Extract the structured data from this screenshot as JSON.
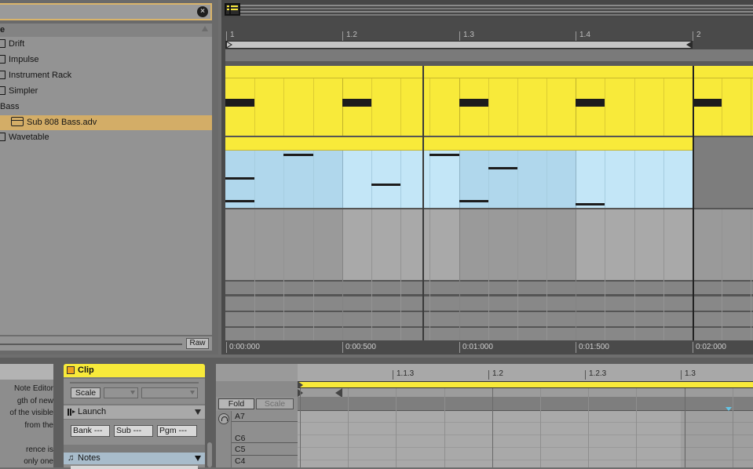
{
  "browser": {
    "search_value": "",
    "clear_icon": "close-circle-icon",
    "header_label": "e",
    "sort_icon": "sort-up-icon",
    "items": [
      {
        "label": "Drift",
        "type": "device",
        "indent": 0,
        "selected": false
      },
      {
        "label": "Impulse",
        "type": "device",
        "indent": 0,
        "selected": false
      },
      {
        "label": "Instrument Rack",
        "type": "device",
        "indent": 0,
        "selected": false
      },
      {
        "label": "Simpler",
        "type": "device",
        "indent": 0,
        "selected": false
      },
      {
        "label": "Bass",
        "type": "folder",
        "indent": 0,
        "selected": false
      },
      {
        "label": "Sub 808 Bass.adv",
        "type": "preset",
        "indent": 1,
        "selected": true
      },
      {
        "label": "Wavetable",
        "type": "device",
        "indent": 0,
        "selected": false
      }
    ],
    "raw_label": "Raw"
  },
  "arrangement": {
    "overview_icon": "overview-clip-icon",
    "bar_ruler": [
      "1",
      "1.2",
      "1.3",
      "1.4",
      "2"
    ],
    "time_ruler": [
      "0:00:000",
      "0:00:500",
      "0:01:000",
      "0:01:500",
      "0:02:000"
    ],
    "colors": {
      "clip_yellow": "#f8ea3a",
      "clip_blue": "#c3e6f7",
      "clip_blue_dark": "#b0d7ec",
      "selection": "#d3ad67"
    },
    "drum_notes_beats": [
      0,
      1,
      2,
      3,
      4
    ],
    "bass_notes": [
      {
        "start": 0,
        "length": 0.25,
        "row": "low"
      },
      {
        "start": 0,
        "length": 0.25,
        "row": "mid"
      },
      {
        "start": 0.5,
        "length": 0.25,
        "row": "high"
      },
      {
        "start": 1.25,
        "length": 0.25,
        "row": "midlow"
      },
      {
        "start": 1.75,
        "length": 0.25,
        "row": "high"
      },
      {
        "start": 2,
        "length": 0.25,
        "row": "low"
      },
      {
        "start": 2.25,
        "length": 0.25,
        "row": "highmid"
      },
      {
        "start": 3,
        "length": 0.25,
        "row": "lowest"
      }
    ]
  },
  "info_panel": {
    "text": " Note Editor\ngth of new\nof the visible\nfrom the\n\nrence is\nonly one"
  },
  "clip_panel": {
    "title": "Clip",
    "color": "#f0a21d",
    "scale_label": "Scale",
    "scale_root": "",
    "scale_name": "",
    "launch_label": "Launch",
    "bank_label": "Bank ---",
    "sub_label": "Sub ---",
    "pgm_label": "Pgm ---",
    "notes_label": "Notes",
    "notes_icon": "music-note-icon"
  },
  "piano_roll": {
    "fold_label": "Fold",
    "scale_label": "Scale",
    "ruler": [
      "1.1.3",
      "1.2",
      "1.2.3",
      "1.3"
    ],
    "keys": [
      "A7",
      "",
      "C6",
      "C5",
      "C4"
    ],
    "headphone_icon": "headphones-icon"
  }
}
